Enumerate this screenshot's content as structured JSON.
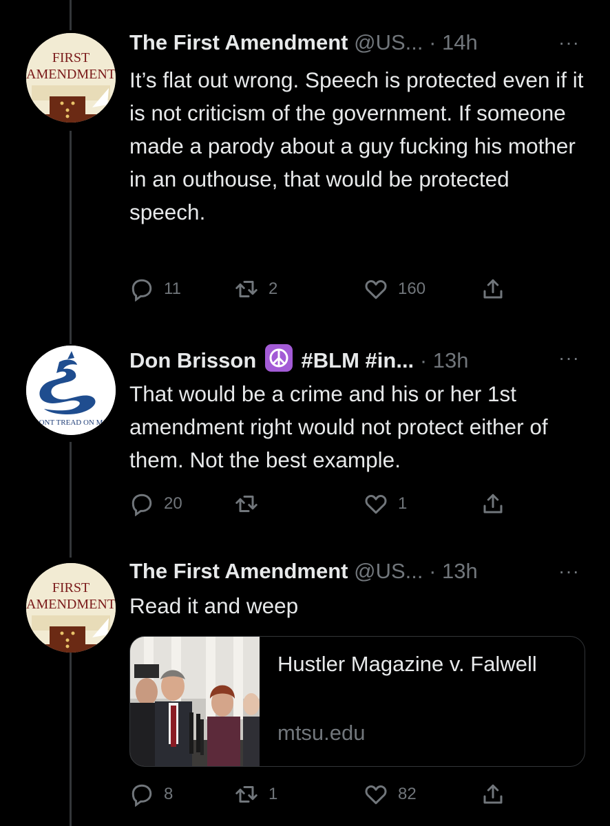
{
  "tweets": [
    {
      "name": "The First Amendment",
      "handle_time": "@US... · 14h",
      "more": "···",
      "text": "It’s flat out wrong. Speech is protected even if it is not criticism of the government. If someone made a parody about a guy fucking his mother in an outhouse, that would be protected speech.",
      "avatar": {
        "line1": "FIRST",
        "line2": "AMENDMENT"
      },
      "replies": "11",
      "retweets": "2",
      "likes": "160"
    },
    {
      "name": "Don Brisson",
      "name_suffix": "#BLM #in...",
      "handle_time": "· 13h",
      "more": "···",
      "text": "That would be a crime and his or her 1st amendment right would not protect either of them.  Not the best example.",
      "avatar": {
        "motto": "ONT TREAD ON M"
      },
      "replies": "20",
      "retweets": "",
      "likes": "1"
    },
    {
      "name": "The First Amendment",
      "handle_time": "@US... · 13h",
      "more": "···",
      "text": "Read it and weep",
      "avatar": {
        "line1": "FIRST",
        "line2": "AMENDMENT"
      },
      "card": {
        "title": "Hustler Magazine v. Falwell",
        "domain": "mtsu.edu"
      },
      "replies": "8",
      "retweets": "1",
      "likes": "82"
    }
  ],
  "icons": {
    "reply": "reply-icon",
    "retweet": "retweet-icon",
    "like": "heart-icon",
    "share": "share-icon",
    "peace": "peace-symbol-emoji"
  },
  "colors": {
    "background": "#000000",
    "text": "#e7e9ea",
    "muted": "#71767b",
    "border": "#333639",
    "peace_badge": "#a35bd6"
  }
}
